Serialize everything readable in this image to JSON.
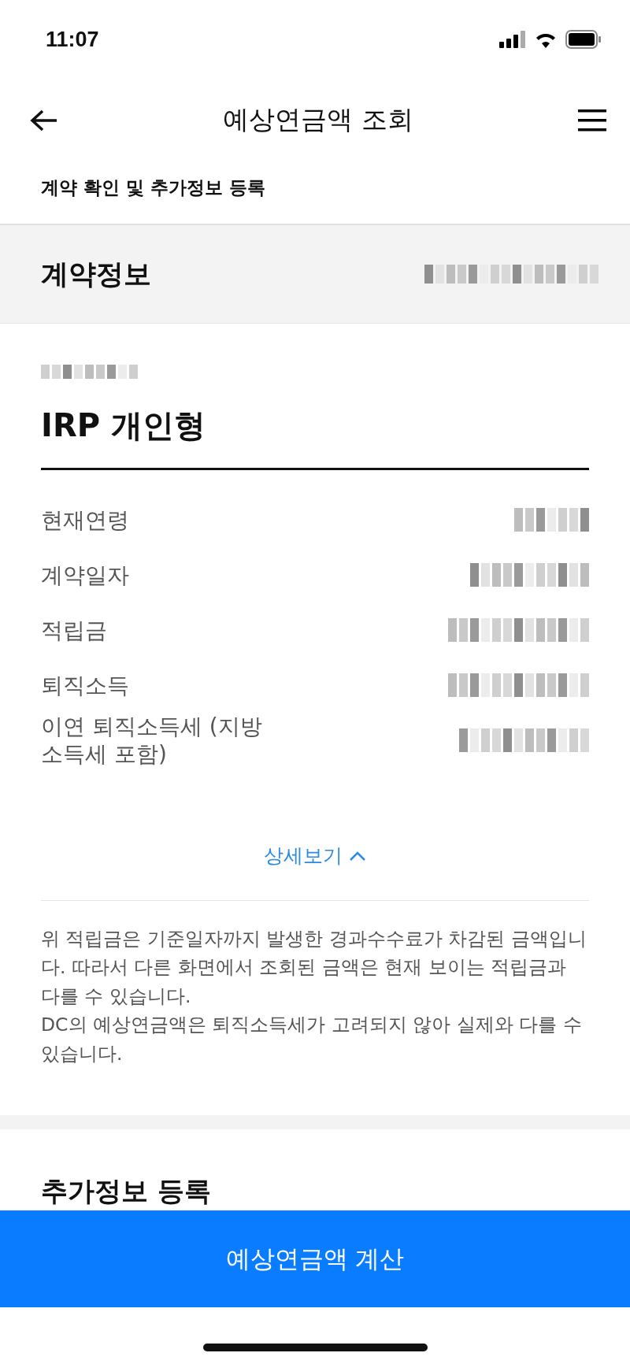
{
  "status_bar": {
    "time": "11:07"
  },
  "header": {
    "title": "예상연금액 조회"
  },
  "subtitle": "계약 확인 및 추가정보 등록",
  "section": {
    "title": "계약정보",
    "meta_redacted": true
  },
  "contract": {
    "label_redacted": true,
    "name": "IRP 개인형"
  },
  "rows": [
    {
      "label": "현재연령",
      "value_redacted": true
    },
    {
      "label": "계약일자",
      "value_redacted": true
    },
    {
      "label": "적립금",
      "value_redacted": true
    },
    {
      "label": "퇴직소득",
      "value_redacted": true
    },
    {
      "label": "이연 퇴직소득세 (지방소득세 포함)",
      "value_redacted": true
    }
  ],
  "details_toggle": {
    "label": "상세보기",
    "expanded": true
  },
  "notes": [
    "위 적립금은 기준일자까지 발생한 경과수수료가 차감된 금액입니다. 따라서 다른 화면에서 조회된 금액은 현재 보이는 적립금과 다를 수 있습니다.",
    "DC의 예상연금액은 퇴직소득세가 고려되지 않아 실제와 다를 수 있습니다."
  ],
  "next_section": {
    "title": "추가정보 등록"
  },
  "primary_button": {
    "label": "예상연금액 계산"
  }
}
